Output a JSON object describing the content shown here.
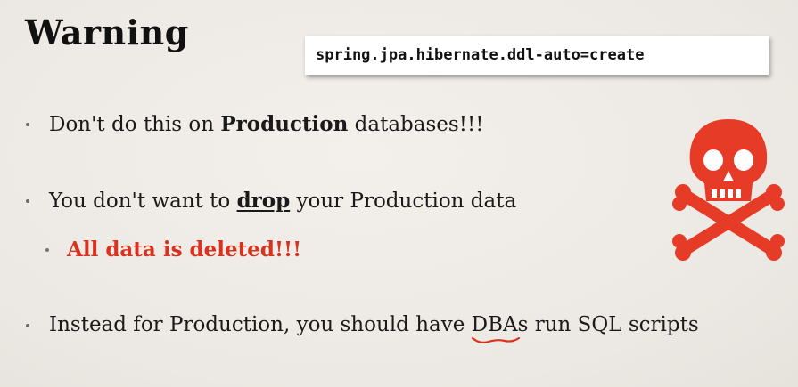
{
  "slide": {
    "title": "Warning",
    "code": "spring.jpa.hibernate.ddl-auto=create",
    "bullets": {
      "b1": {
        "pre": "Don't do this on ",
        "strong": "Production",
        "post": " databases!!!"
      },
      "b2": {
        "pre": "You don't want to ",
        "emph": "drop",
        "post": " your Production data"
      },
      "b3": {
        "text": "All data is deleted!!!"
      },
      "b4": {
        "pre": "Instead for Production, you should have ",
        "mark": "DBAs",
        "post": " run SQL scripts"
      }
    },
    "icon": "skull-and-crossbones-icon",
    "colors": {
      "accent_red": "#d9331f",
      "background": "#efebe6"
    }
  }
}
